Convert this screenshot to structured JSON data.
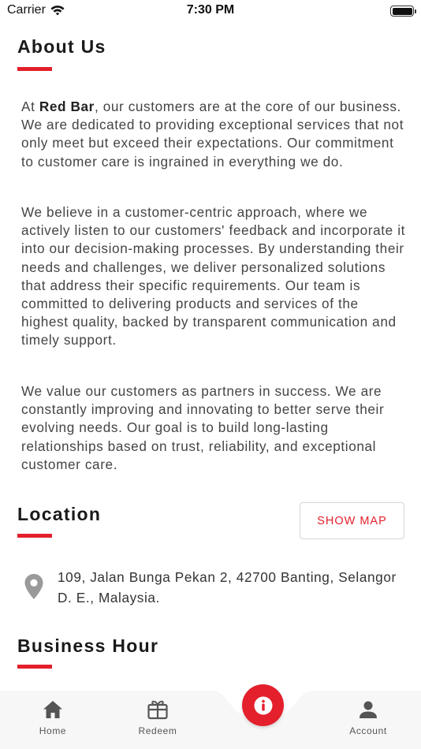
{
  "status_bar": {
    "carrier": "Carrier",
    "time": "7:30 PM",
    "wifi_icon": "wifi-icon",
    "battery_icon": "battery-icon"
  },
  "about": {
    "title": "About Us",
    "p1_prefix": "At ",
    "p1_bold": "Red Bar",
    "p1_rest": ", our customers are at the core of our business. We are dedicated to providing exceptional services that not only meet but exceed their expectations. Our commitment to customer care is ingrained in everything we do.",
    "p2": "We believe in a customer-centric approach, where we actively listen to our customers' feedback and incorporate it into our decision-making processes. By understanding their needs and challenges, we deliver personalized solutions that address their specific requirements. Our team is committed to delivering products and services of the highest quality, backed by transparent communication and timely support.",
    "p3": "We value our customers as partners in success. We are constantly improving and innovating to better serve their evolving needs. Our goal is to build long-lasting relationships based on trust, reliability, and exceptional customer care."
  },
  "location": {
    "title": "Location",
    "show_map_label": "SHOW MAP",
    "address": "109, Jalan Bunga Pekan 2, 42700 Banting, Selangor D. E., Malaysia.",
    "icon": "location-pin-icon"
  },
  "business_hour": {
    "title": "Business Hour"
  },
  "nav": {
    "items": [
      {
        "label": "Home",
        "icon": "home-icon"
      },
      {
        "label": "Redeem",
        "icon": "gift-icon"
      },
      {
        "label": "Account",
        "icon": "person-icon"
      }
    ],
    "center_icon": "info-icon"
  },
  "colors": {
    "accent": "#e3202c",
    "text": "#444444",
    "nav_bg": "#f7f7f7",
    "icon_gray": "#555555"
  }
}
